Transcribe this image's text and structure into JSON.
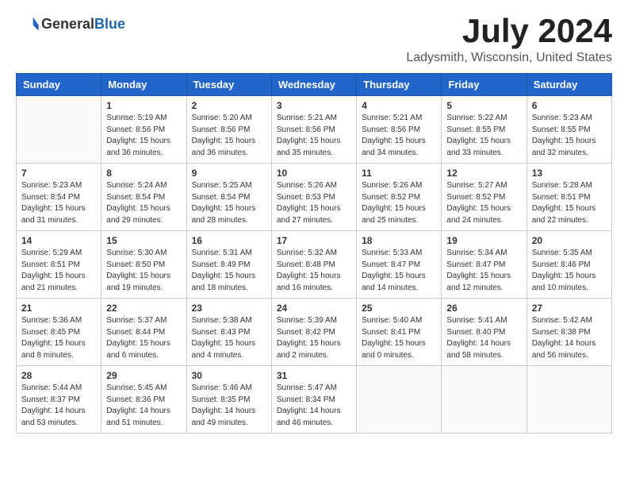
{
  "header": {
    "logo_general": "General",
    "logo_blue": "Blue",
    "month_title": "July 2024",
    "location": "Ladysmith, Wisconsin, United States"
  },
  "days_of_week": [
    "Sunday",
    "Monday",
    "Tuesday",
    "Wednesday",
    "Thursday",
    "Friday",
    "Saturday"
  ],
  "weeks": [
    [
      {
        "day": "",
        "info": ""
      },
      {
        "day": "1",
        "info": "Sunrise: 5:19 AM\nSunset: 8:56 PM\nDaylight: 15 hours\nand 36 minutes."
      },
      {
        "day": "2",
        "info": "Sunrise: 5:20 AM\nSunset: 8:56 PM\nDaylight: 15 hours\nand 36 minutes."
      },
      {
        "day": "3",
        "info": "Sunrise: 5:21 AM\nSunset: 8:56 PM\nDaylight: 15 hours\nand 35 minutes."
      },
      {
        "day": "4",
        "info": "Sunrise: 5:21 AM\nSunset: 8:56 PM\nDaylight: 15 hours\nand 34 minutes."
      },
      {
        "day": "5",
        "info": "Sunrise: 5:22 AM\nSunset: 8:55 PM\nDaylight: 15 hours\nand 33 minutes."
      },
      {
        "day": "6",
        "info": "Sunrise: 5:23 AM\nSunset: 8:55 PM\nDaylight: 15 hours\nand 32 minutes."
      }
    ],
    [
      {
        "day": "7",
        "info": "Sunrise: 5:23 AM\nSunset: 8:54 PM\nDaylight: 15 hours\nand 31 minutes."
      },
      {
        "day": "8",
        "info": "Sunrise: 5:24 AM\nSunset: 8:54 PM\nDaylight: 15 hours\nand 29 minutes."
      },
      {
        "day": "9",
        "info": "Sunrise: 5:25 AM\nSunset: 8:54 PM\nDaylight: 15 hours\nand 28 minutes."
      },
      {
        "day": "10",
        "info": "Sunrise: 5:26 AM\nSunset: 8:53 PM\nDaylight: 15 hours\nand 27 minutes."
      },
      {
        "day": "11",
        "info": "Sunrise: 5:26 AM\nSunset: 8:52 PM\nDaylight: 15 hours\nand 25 minutes."
      },
      {
        "day": "12",
        "info": "Sunrise: 5:27 AM\nSunset: 8:52 PM\nDaylight: 15 hours\nand 24 minutes."
      },
      {
        "day": "13",
        "info": "Sunrise: 5:28 AM\nSunset: 8:51 PM\nDaylight: 15 hours\nand 22 minutes."
      }
    ],
    [
      {
        "day": "14",
        "info": "Sunrise: 5:29 AM\nSunset: 8:51 PM\nDaylight: 15 hours\nand 21 minutes."
      },
      {
        "day": "15",
        "info": "Sunrise: 5:30 AM\nSunset: 8:50 PM\nDaylight: 15 hours\nand 19 minutes."
      },
      {
        "day": "16",
        "info": "Sunrise: 5:31 AM\nSunset: 8:49 PM\nDaylight: 15 hours\nand 18 minutes."
      },
      {
        "day": "17",
        "info": "Sunrise: 5:32 AM\nSunset: 8:48 PM\nDaylight: 15 hours\nand 16 minutes."
      },
      {
        "day": "18",
        "info": "Sunrise: 5:33 AM\nSunset: 8:47 PM\nDaylight: 15 hours\nand 14 minutes."
      },
      {
        "day": "19",
        "info": "Sunrise: 5:34 AM\nSunset: 8:47 PM\nDaylight: 15 hours\nand 12 minutes."
      },
      {
        "day": "20",
        "info": "Sunrise: 5:35 AM\nSunset: 8:46 PM\nDaylight: 15 hours\nand 10 minutes."
      }
    ],
    [
      {
        "day": "21",
        "info": "Sunrise: 5:36 AM\nSunset: 8:45 PM\nDaylight: 15 hours\nand 8 minutes."
      },
      {
        "day": "22",
        "info": "Sunrise: 5:37 AM\nSunset: 8:44 PM\nDaylight: 15 hours\nand 6 minutes."
      },
      {
        "day": "23",
        "info": "Sunrise: 5:38 AM\nSunset: 8:43 PM\nDaylight: 15 hours\nand 4 minutes."
      },
      {
        "day": "24",
        "info": "Sunrise: 5:39 AM\nSunset: 8:42 PM\nDaylight: 15 hours\nand 2 minutes."
      },
      {
        "day": "25",
        "info": "Sunrise: 5:40 AM\nSunset: 8:41 PM\nDaylight: 15 hours\nand 0 minutes."
      },
      {
        "day": "26",
        "info": "Sunrise: 5:41 AM\nSunset: 8:40 PM\nDaylight: 14 hours\nand 58 minutes."
      },
      {
        "day": "27",
        "info": "Sunrise: 5:42 AM\nSunset: 8:38 PM\nDaylight: 14 hours\nand 56 minutes."
      }
    ],
    [
      {
        "day": "28",
        "info": "Sunrise: 5:44 AM\nSunset: 8:37 PM\nDaylight: 14 hours\nand 53 minutes."
      },
      {
        "day": "29",
        "info": "Sunrise: 5:45 AM\nSunset: 8:36 PM\nDaylight: 14 hours\nand 51 minutes."
      },
      {
        "day": "30",
        "info": "Sunrise: 5:46 AM\nSunset: 8:35 PM\nDaylight: 14 hours\nand 49 minutes."
      },
      {
        "day": "31",
        "info": "Sunrise: 5:47 AM\nSunset: 8:34 PM\nDaylight: 14 hours\nand 46 minutes."
      },
      {
        "day": "",
        "info": ""
      },
      {
        "day": "",
        "info": ""
      },
      {
        "day": "",
        "info": ""
      }
    ]
  ]
}
